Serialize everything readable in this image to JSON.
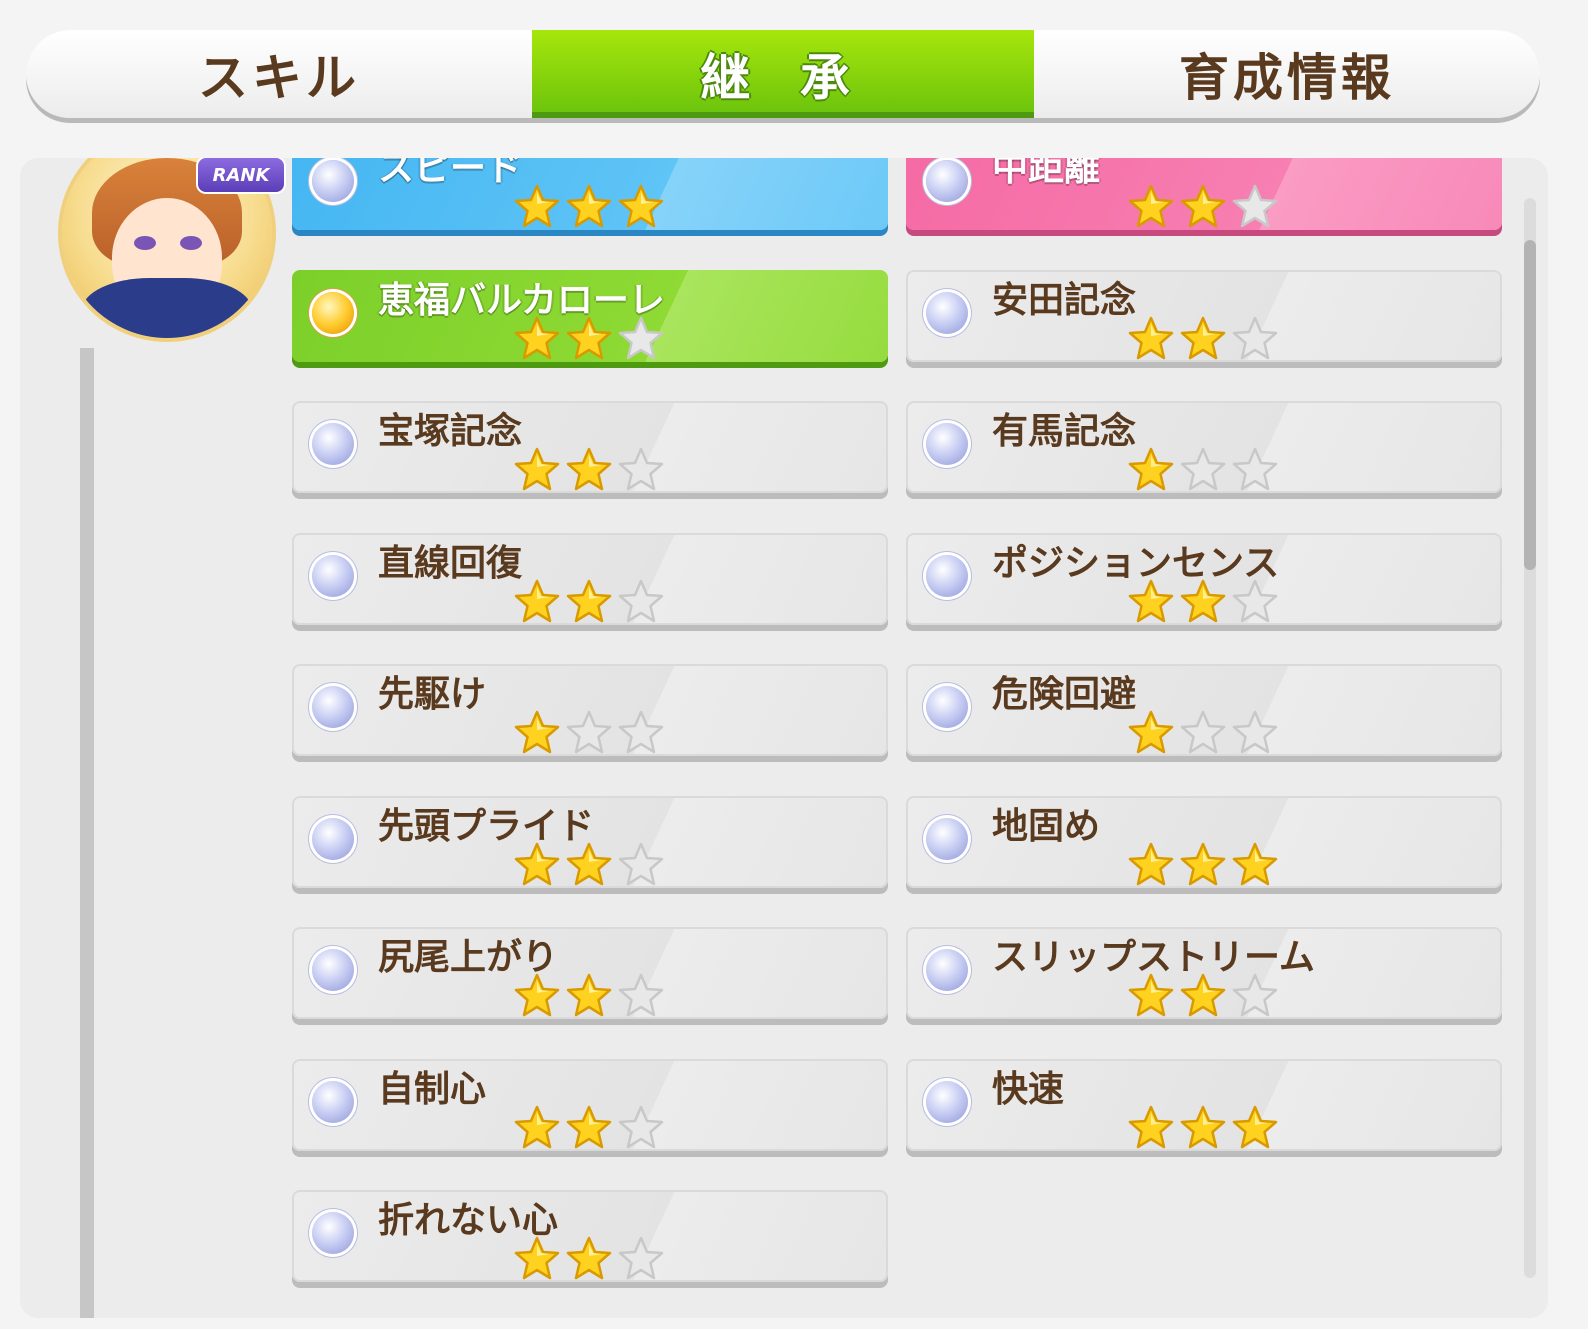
{
  "tabs": [
    {
      "label": "スキル",
      "active": false
    },
    {
      "label": "継 承",
      "active": true
    },
    {
      "label": "育成情報",
      "active": false
    }
  ],
  "rank_badge": "RANK",
  "max_stars": 3,
  "colors": {
    "blue": "#44b6f2",
    "pink": "#f56aa4",
    "green": "#7ccf2a",
    "star_on": "#ffd21f",
    "star_off": "#e8e8e8"
  },
  "factors_left": [
    {
      "label": "スピード",
      "stars": 3,
      "type": "blue",
      "icon": "orb-icon"
    },
    {
      "label": "恵福バルカローレ",
      "stars": 2,
      "type": "green",
      "icon": "gold-orb-icon"
    },
    {
      "label": "宝塚記念",
      "stars": 2,
      "type": "white",
      "icon": "orb-icon"
    },
    {
      "label": "直線回復",
      "stars": 2,
      "type": "white",
      "icon": "orb-icon"
    },
    {
      "label": "先駆け",
      "stars": 1,
      "type": "white",
      "icon": "orb-icon"
    },
    {
      "label": "先頭プライド",
      "stars": 2,
      "type": "white",
      "icon": "orb-icon"
    },
    {
      "label": "尻尾上がり",
      "stars": 2,
      "type": "white",
      "icon": "orb-icon"
    },
    {
      "label": "自制心",
      "stars": 2,
      "type": "white",
      "icon": "orb-icon"
    },
    {
      "label": "折れない心",
      "stars": 2,
      "type": "white",
      "icon": "orb-icon"
    }
  ],
  "factors_right": [
    {
      "label": "中距離",
      "stars": 2,
      "type": "pink",
      "icon": "orb-icon"
    },
    {
      "label": "安田記念",
      "stars": 2,
      "type": "white",
      "icon": "orb-icon"
    },
    {
      "label": "有馬記念",
      "stars": 1,
      "type": "white",
      "icon": "orb-icon"
    },
    {
      "label": "ポジションセンス",
      "stars": 2,
      "type": "white",
      "icon": "orb-icon"
    },
    {
      "label": "危険回避",
      "stars": 1,
      "type": "white",
      "icon": "orb-icon"
    },
    {
      "label": "地固め",
      "stars": 3,
      "type": "white",
      "icon": "orb-icon"
    },
    {
      "label": "スリップストリーム",
      "stars": 2,
      "type": "white",
      "icon": "orb-icon"
    },
    {
      "label": "快速",
      "stars": 3,
      "type": "white",
      "icon": "orb-icon"
    }
  ]
}
